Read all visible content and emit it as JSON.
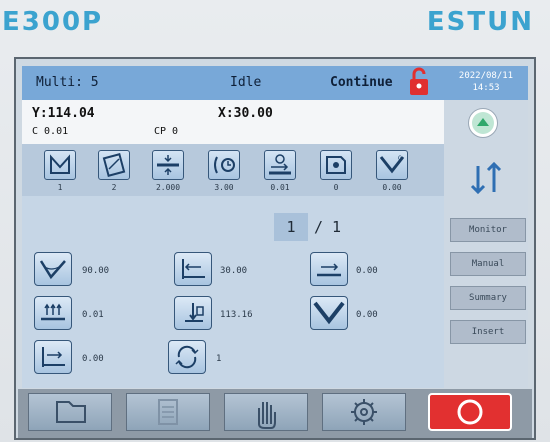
{
  "brand": {
    "model": "E300P",
    "logo": "ESTUN"
  },
  "status": {
    "multi": "Multi: 5",
    "state": "Idle",
    "mode": "Continue",
    "date": "2022/08/11",
    "time": "14:53"
  },
  "position": {
    "y": "Y:114.04",
    "x": "X:30.00",
    "c": "C  0.01",
    "cp": "CP 0"
  },
  "top_icons": [
    {
      "icon": "die-icon",
      "value": "1"
    },
    {
      "icon": "punch-icon",
      "value": "2"
    },
    {
      "icon": "thickness-icon",
      "value": "2.000"
    },
    {
      "icon": "length-icon",
      "value": "3.00"
    },
    {
      "icon": "backgauge-icon",
      "value": "0.01"
    },
    {
      "icon": "material-icon",
      "value": "0"
    },
    {
      "icon": "angle-icon",
      "value": "0.00"
    }
  ],
  "pager": {
    "current": "1",
    "separator": "/",
    "total": "1"
  },
  "params": [
    {
      "icon": "bend-angle-icon",
      "value": "90.00"
    },
    {
      "icon": "x-axis-icon",
      "value": "30.00"
    },
    {
      "icon": "r-axis-icon",
      "value": "0.00"
    },
    {
      "icon": "pressure-icon",
      "value": "0.01"
    },
    {
      "icon": "y-axis-icon",
      "value": "113.16"
    },
    {
      "icon": "crowning-icon",
      "value": "0.00"
    },
    {
      "icon": "retract-icon",
      "value": "0.00"
    },
    {
      "icon": "repeat-icon",
      "value": "1"
    }
  ],
  "sidebar": {
    "buttons": [
      "Monitor",
      "Manual",
      "Summary",
      "Insert"
    ]
  },
  "bottom_bar": [
    "folder-icon",
    "document-icon",
    "hand-icon",
    "gear-icon",
    "stop-icon"
  ],
  "colors": {
    "header": "#78a8d8",
    "accent": "#3ba3cf",
    "stop": "#e23030",
    "lock": "#e03030"
  }
}
